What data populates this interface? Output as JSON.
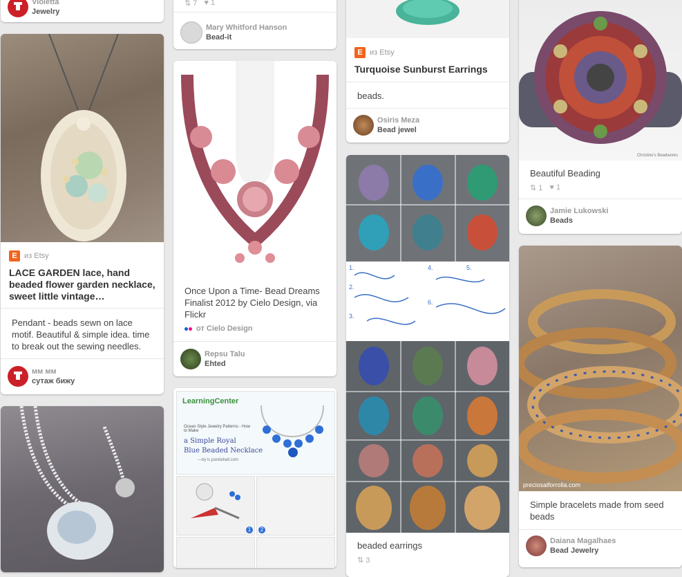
{
  "pins": {
    "p1": {
      "user": "Violetta",
      "board": "Jewelry"
    },
    "p2": {
      "stats": {
        "repins": "7",
        "likes": "1"
      },
      "user": "Mary Whitford Hanson",
      "board": "Bead-it"
    },
    "p3": {
      "source": "из Etsy",
      "title": "Turquoise Sunburst Earrings",
      "desc": "beads.",
      "user": "Osiris Meza",
      "board": "Bead jewel"
    },
    "p4": {
      "image_credit": "Christine's Beadworks",
      "desc": "Beautiful Beading",
      "stats": {
        "repins": "1",
        "likes": "1"
      },
      "user": "Jamie Lukowski",
      "board": "Beads"
    },
    "p5": {
      "source": "из Etsy",
      "title": "LACE GARDEN lace, hand beaded flower garden necklace, sweet little vintage…",
      "desc": "Pendant - beads sewn on lace motif. Beautiful & simple idea. time to break out the sewing needles.",
      "user": "мм мм",
      "board": "сутаж бижу"
    },
    "p6": {
      "desc": "Once Upon a Time- Bead Dreams Finalist 2012 by Cielo Design, via Flickr",
      "source": "от Cielo Design",
      "user": "Repsu Talu",
      "board": "Ehted"
    },
    "p7": {
      "desc": "beaded earrings",
      "stats": {
        "repins": "3"
      },
      "steps": [
        "1.",
        "2.",
        "3.",
        "4.",
        "5.",
        "6."
      ]
    },
    "p8": {
      "image_credit": "preciosalforrolla.com",
      "desc": "Simple bracelets made from seed beads",
      "user": "Daiana Magalhaes",
      "board": "Bead Jewelry"
    },
    "p9": {
      "logo": "LearningCenter",
      "small": "Ocean Style Jewelry Patterns - How to Make",
      "line1": "a Simple Royal",
      "line2": "Blue Beaded Necklace",
      "by": "—by lc.pandahall.com",
      "steps": [
        "1",
        "2"
      ]
    }
  },
  "colors": {
    "pin_red": "#cb2027",
    "etsy_orange": "#f1641e"
  }
}
